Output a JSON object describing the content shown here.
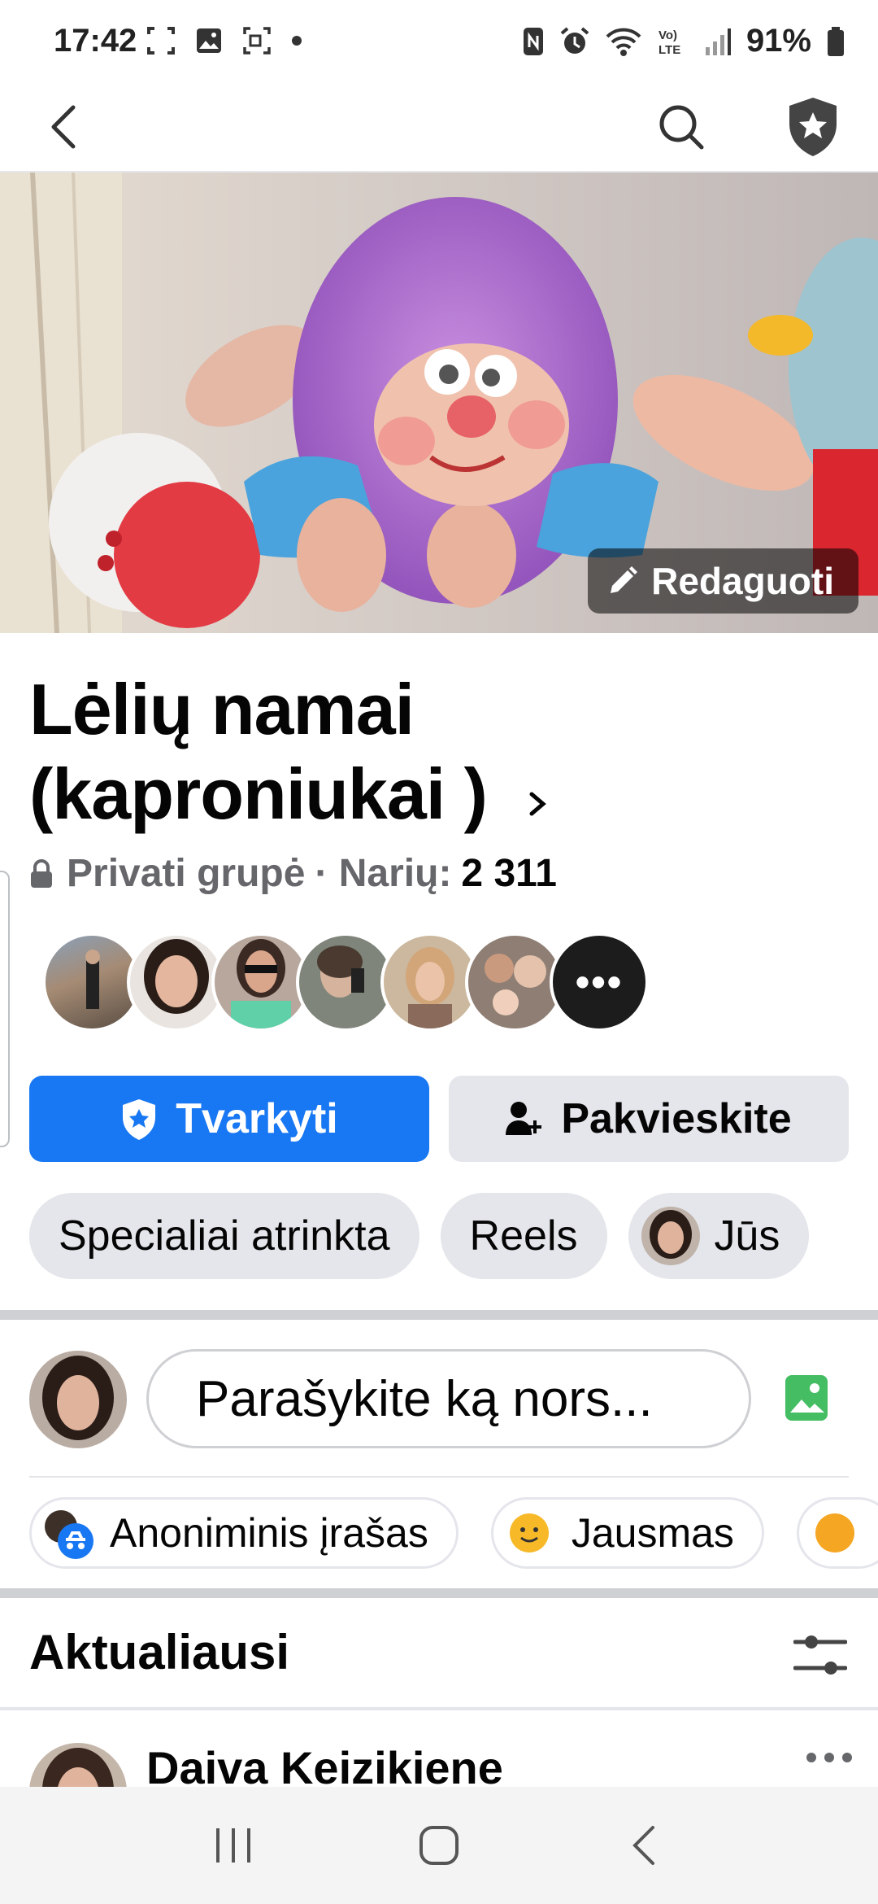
{
  "status_bar": {
    "time": "17:42",
    "battery": "91%",
    "left_icons": [
      "screenshot-icon",
      "gallery-icon",
      "screen-record-icon",
      "dot-icon"
    ],
    "right_icons": [
      "nfc-icon",
      "alarm-icon",
      "wifi-icon",
      "volte-icon",
      "signal-icon",
      "battery-icon"
    ]
  },
  "header": {
    "back_icon": "back-arrow-icon",
    "search_icon": "search-icon",
    "admin_icon": "admin-shield-icon"
  },
  "cover": {
    "edit_label": "Redaguoti",
    "edit_icon": "pencil-icon"
  },
  "group": {
    "title": "Lėlių namai (kaproniukai )",
    "privacy": "Privati grupė",
    "members_label": "· Narių:",
    "members_count": "2 311",
    "more_members": "•••"
  },
  "actions": {
    "manage_label": "Tvarkyti",
    "invite_label": "Pakvieskite"
  },
  "tabs": [
    {
      "label": "Specialiai atrinkta"
    },
    {
      "label": "Reels"
    },
    {
      "label": "Jūs"
    }
  ],
  "composer": {
    "placeholder": "Parašykite ką nors...",
    "anonymous_label": "Anoniminis įrašas",
    "feeling_label": "Jausmas"
  },
  "feed": {
    "sort_title": "Aktualiausi",
    "first_post_author": "Daiva Keizikiene"
  },
  "colors": {
    "primary": "#1877f2",
    "chip_bg": "#e4e6eb",
    "secondary_text": "#65676b",
    "photo_green": "#45bd62"
  }
}
